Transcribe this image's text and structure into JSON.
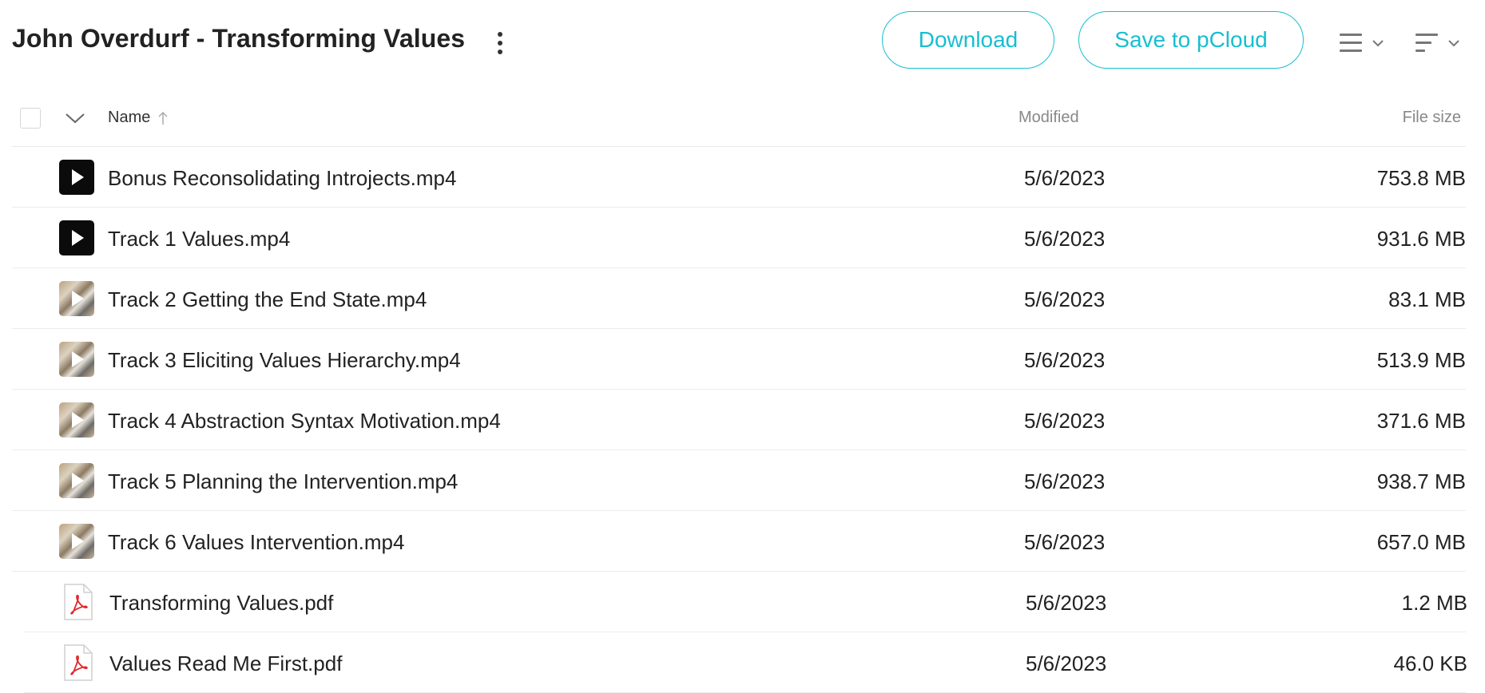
{
  "header": {
    "title": "John Overdurf - Transforming Values",
    "download_label": "Download",
    "save_label": "Save to pCloud"
  },
  "columns": {
    "name": "Name",
    "modified": "Modified",
    "size": "File size"
  },
  "colors": {
    "accent": "#17bed0",
    "pdf_red": "#e0262b"
  },
  "files": [
    {
      "name": "Bonus Reconsolidating Introjects.mp4",
      "modified": "5/6/2023",
      "size": "753.8 MB",
      "icon": "video-thumbnail-dark"
    },
    {
      "name": "Track 1 Values.mp4",
      "modified": "5/6/2023",
      "size": "931.6 MB",
      "icon": "video-thumbnail-dark"
    },
    {
      "name": "Track 2 Getting the End State.mp4",
      "modified": "5/6/2023",
      "size": "83.1 MB",
      "icon": "video-thumbnail-photo"
    },
    {
      "name": "Track 3 Eliciting Values Hierarchy.mp4",
      "modified": "5/6/2023",
      "size": "513.9 MB",
      "icon": "video-thumbnail-photo"
    },
    {
      "name": "Track 4 Abstraction Syntax Motivation.mp4",
      "modified": "5/6/2023",
      "size": "371.6 MB",
      "icon": "video-thumbnail-photo"
    },
    {
      "name": "Track 5 Planning the Intervention.mp4",
      "modified": "5/6/2023",
      "size": "938.7 MB",
      "icon": "video-thumbnail-photo"
    },
    {
      "name": "Track 6 Values Intervention.mp4",
      "modified": "5/6/2023",
      "size": "657.0 MB",
      "icon": "video-thumbnail-photo"
    },
    {
      "name": "Transforming Values.pdf",
      "modified": "5/6/2023",
      "size": "1.2 MB",
      "icon": "pdf-icon"
    },
    {
      "name": "Values Read Me First.pdf",
      "modified": "5/6/2023",
      "size": "46.0 KB",
      "icon": "pdf-icon"
    }
  ]
}
